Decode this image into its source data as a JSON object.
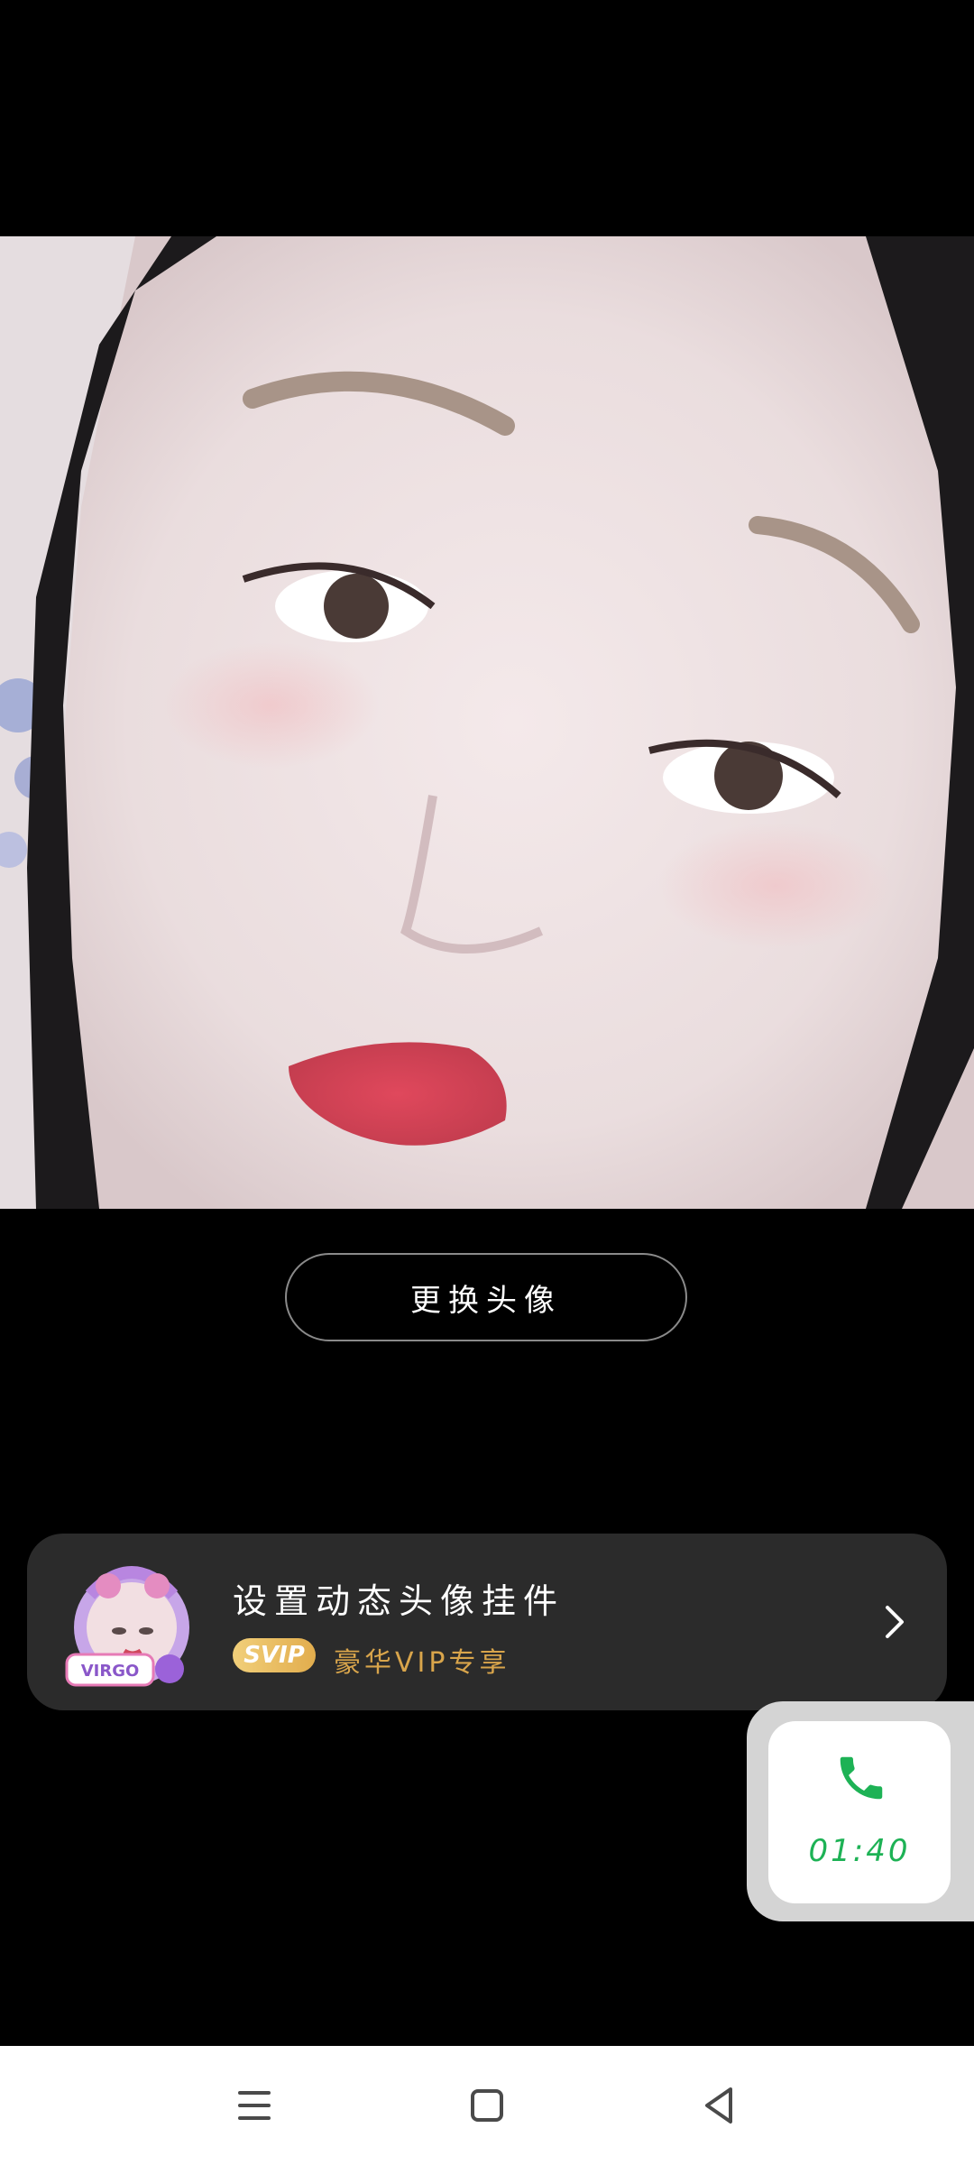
{
  "avatar": {
    "change_button_label": "更换头像"
  },
  "pendant_card": {
    "title": "设置动态头像挂件",
    "badge": "SVIP",
    "subtitle": "豪华VIP专享",
    "thumb_text_virgo": "VIRGO",
    "thumb_icon": "virgo-pendant-thumbnail",
    "chevron_icon": "chevron-right-icon"
  },
  "call_float": {
    "timer": "01:40",
    "icon": "phone-icon",
    "accent_color": "#1db255"
  },
  "nav_bar": {
    "menu_icon": "menu-icon",
    "home_icon": "home-square-icon",
    "back_icon": "back-triangle-icon"
  },
  "colors": {
    "background": "#000000",
    "card": "#2b2b2b",
    "svip_gold": "#e2ad4d",
    "vip_text": "#d9a54b"
  }
}
